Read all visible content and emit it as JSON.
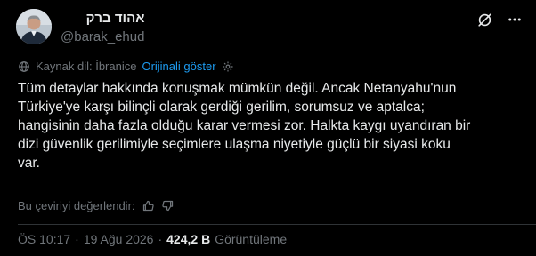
{
  "author": {
    "display_name": "אהוד ברק",
    "handle": "@barak_ehud"
  },
  "translation": {
    "source_label": "Kaynak dil: İbranice",
    "show_original": "Orijinali göster"
  },
  "tweet": {
    "text": "Tüm detaylar hakkında konuşmak mümkün değil. Ancak Netanyahu'nun\nTürkiye'ye karşı bilinçli olarak gerdiği gerilim, sorumsuz ve aptalca;\nhangisinin daha fazla olduğu karar vermesi zor. Halkta kaygı uyandıran bir\ndizi güvenlik gerilimiyle seçimlere ulaşma niyetiyle güçlü bir siyasi koku\nvar."
  },
  "rating": {
    "prompt": "Bu çeviriyi değerlendir:"
  },
  "meta": {
    "time": "ÖS 10:17",
    "date": "19 Ağu 2026",
    "separator": "·",
    "views": "424,2 B",
    "views_label": "Görüntüleme"
  },
  "icons": [
    "grok-icon",
    "more-icon",
    "globe-icon",
    "gear-icon",
    "thumbs-up-icon",
    "thumbs-down-icon"
  ],
  "colors": {
    "background": "#000000",
    "text": "#e7e9ea",
    "muted": "#71767b",
    "link": "#1d9bf0",
    "divider": "#2f3336"
  }
}
